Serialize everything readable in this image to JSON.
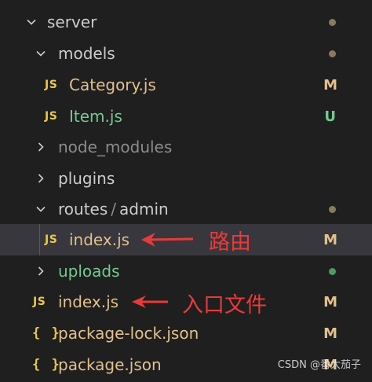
{
  "explorer": {
    "items": [
      {
        "label": "server",
        "status": "",
        "dot": "#8a7a60"
      },
      {
        "label": "models",
        "status": "",
        "dot": "#8a7a60"
      },
      {
        "label": "Category.js",
        "status": "M"
      },
      {
        "label": "Item.js",
        "status": "U"
      },
      {
        "label": "node_modules",
        "status": ""
      },
      {
        "label": "plugins",
        "status": ""
      },
      {
        "label_a": "routes",
        "label_sep": "/",
        "label_b": "admin",
        "status": "",
        "dot": "#8a7a60"
      },
      {
        "label": "index.js",
        "status": "M"
      },
      {
        "label": "uploads",
        "status": "",
        "dot": "#4f9a62"
      },
      {
        "label": "index.js",
        "status": "M"
      },
      {
        "label": "package-lock.json",
        "status": "M"
      },
      {
        "label": "package.json",
        "status": "M"
      }
    ],
    "icons": {
      "js": "JS",
      "json": "{ }"
    }
  },
  "annotations": {
    "route_note": "路由",
    "entry_note": "入口文件"
  },
  "watermark": "CSDN @番大茄子"
}
